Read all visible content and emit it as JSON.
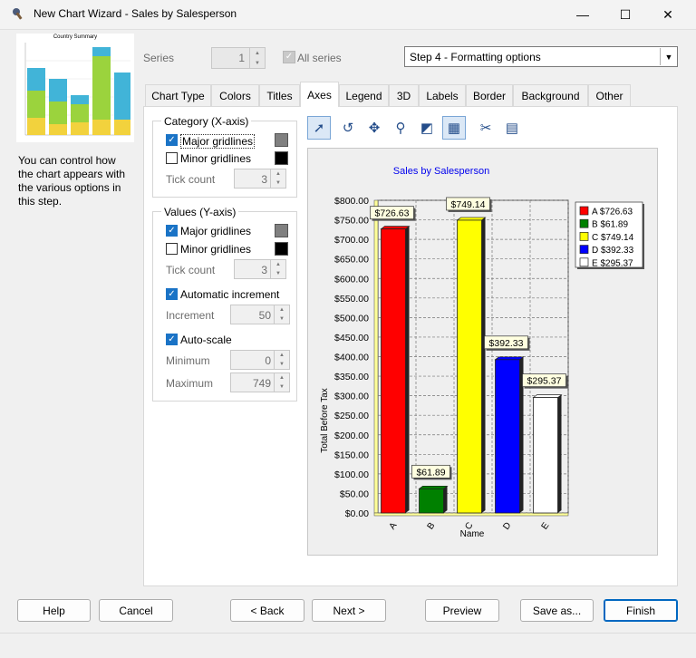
{
  "window": {
    "title": "New Chart Wizard - Sales by Salesperson",
    "minimize": "—",
    "maximize": "☐",
    "close": "✕"
  },
  "preview": {
    "title": "Country Summary"
  },
  "help_text": "You can control how the chart appears with the various options in this step.",
  "series": {
    "label": "Series",
    "value": "1",
    "all_series_label": "All series",
    "all_series_checked": true
  },
  "step_select": {
    "value": "Step 4 - Formatting options"
  },
  "tabs": [
    "Chart Type",
    "Colors",
    "Titles",
    "Axes",
    "Legend",
    "3D",
    "Labels",
    "Border",
    "Background",
    "Other"
  ],
  "active_tab": "Axes",
  "category_group": {
    "title": "Category (X-axis)",
    "major_label": "Major gridlines",
    "major_checked": true,
    "major_color": "#808080",
    "minor_label": "Minor gridlines",
    "minor_checked": false,
    "minor_color": "#000000",
    "tick_label": "Tick count",
    "tick_value": "3"
  },
  "values_group": {
    "title": "Values (Y-axis)",
    "major_label": "Major gridlines",
    "major_checked": true,
    "major_color": "#808080",
    "minor_label": "Minor gridlines",
    "minor_checked": false,
    "minor_color": "#000000",
    "tick_label": "Tick count",
    "tick_value": "3",
    "auto_inc_label": "Automatic increment",
    "auto_inc_checked": true,
    "increment_label": "Increment",
    "increment_value": "50",
    "autoscale_label": "Auto-scale",
    "autoscale_checked": true,
    "minimum_label": "Minimum",
    "minimum_value": "0",
    "maximum_label": "Maximum",
    "maximum_value": "749"
  },
  "toolbar_icons": [
    "pointer-icon",
    "rotate-icon",
    "move-icon",
    "zoom-icon",
    "export-image-icon",
    "3d-toggle-icon",
    "tools-icon",
    "data-grid-icon"
  ],
  "chart_data": {
    "type": "bar",
    "title": "Sales by Salesperson",
    "xlabel": "Name",
    "ylabel": "Total Before Tax",
    "categories": [
      "A",
      "B",
      "C",
      "D",
      "E"
    ],
    "values": [
      726.63,
      61.89,
      749.14,
      392.33,
      295.37
    ],
    "data_labels": [
      "$726.63",
      "$61.89",
      "$749.14",
      "$392.33",
      "$295.37"
    ],
    "colors": [
      "#ff0000",
      "#008000",
      "#ffff00",
      "#0000ff",
      "#ffffff"
    ],
    "ylim": [
      0,
      800
    ],
    "ytick_step": 50,
    "legend": [
      "A $726.63",
      "B   $61.89",
      "C $749.14",
      "D $392.33",
      "E $295.37"
    ],
    "legend_position": "right",
    "grid": true
  },
  "buttons": {
    "help": "Help",
    "cancel": "Cancel",
    "back": "< Back",
    "next": "Next >",
    "preview": "Preview",
    "save_as": "Save as...",
    "finish": "Finish"
  }
}
